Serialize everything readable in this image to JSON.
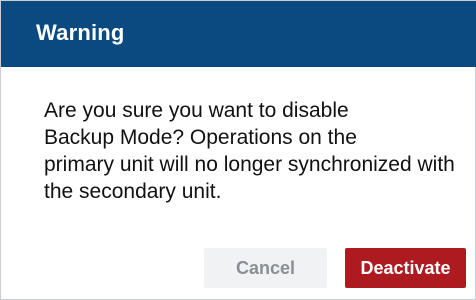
{
  "dialog": {
    "title": "Warning",
    "message_lines": [
      "Are you sure you want to disable",
      "Backup Mode? Operations on the",
      "primary unit will no longer synchronized with",
      "the secondary unit."
    ],
    "cancel_label": "Cancel",
    "confirm_label": "Deactivate"
  },
  "colors": {
    "header_background": "#0b4a80",
    "confirm_button": "#ad1a20",
    "cancel_button": "#f1f2f4"
  }
}
